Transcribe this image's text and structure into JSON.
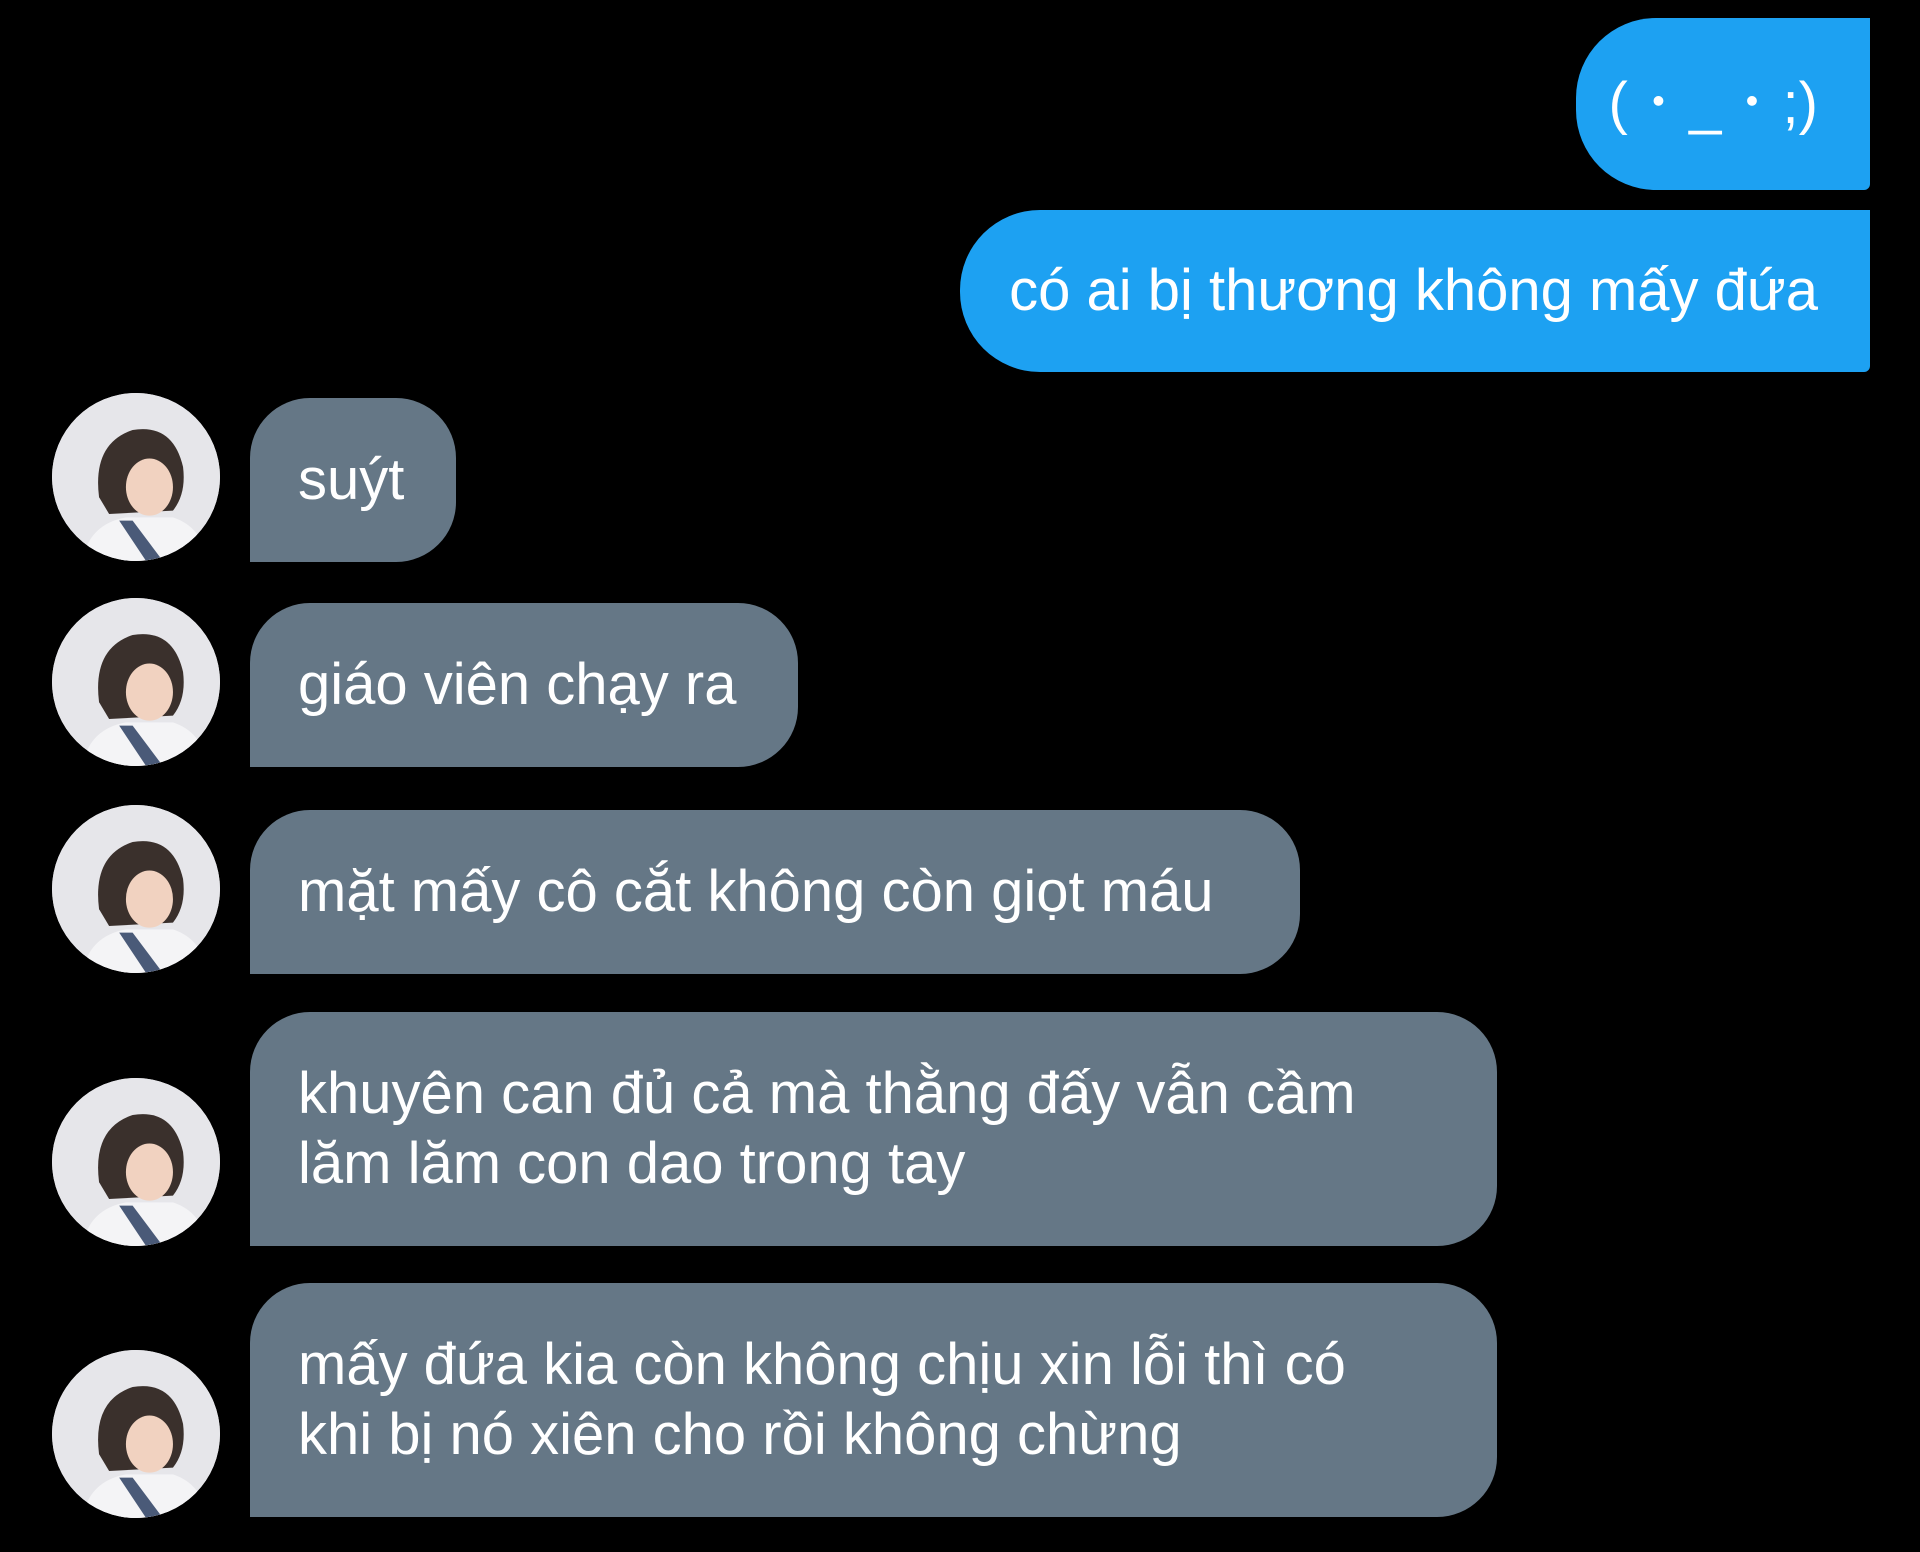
{
  "conversation": {
    "sent_messages": [
      {
        "text": "( ･ _ ･ ;)"
      },
      {
        "text": "có ai bị thương không mấy đứa"
      }
    ],
    "received_messages": [
      {
        "lines": [
          "suýt"
        ]
      },
      {
        "lines": [
          "giáo viên chạy ra"
        ]
      },
      {
        "lines": [
          "mặt mấy cô cắt không còn giọt máu"
        ]
      },
      {
        "lines": [
          "khuyên can đủ cả mà thằng đấy vẫn cầm",
          "lăm lăm con dao trong tay"
        ]
      },
      {
        "lines": [
          "mấy đứa kia còn không chịu xin lỗi thì có",
          "khi bị nó xiên cho rồi không chừng"
        ]
      }
    ],
    "avatar_icon": "user-avatar-icon"
  },
  "colors": {
    "background": "#000000",
    "sent_bubble": "#1da1f2",
    "received_bubble": "#657786",
    "text": "#ffffff"
  }
}
